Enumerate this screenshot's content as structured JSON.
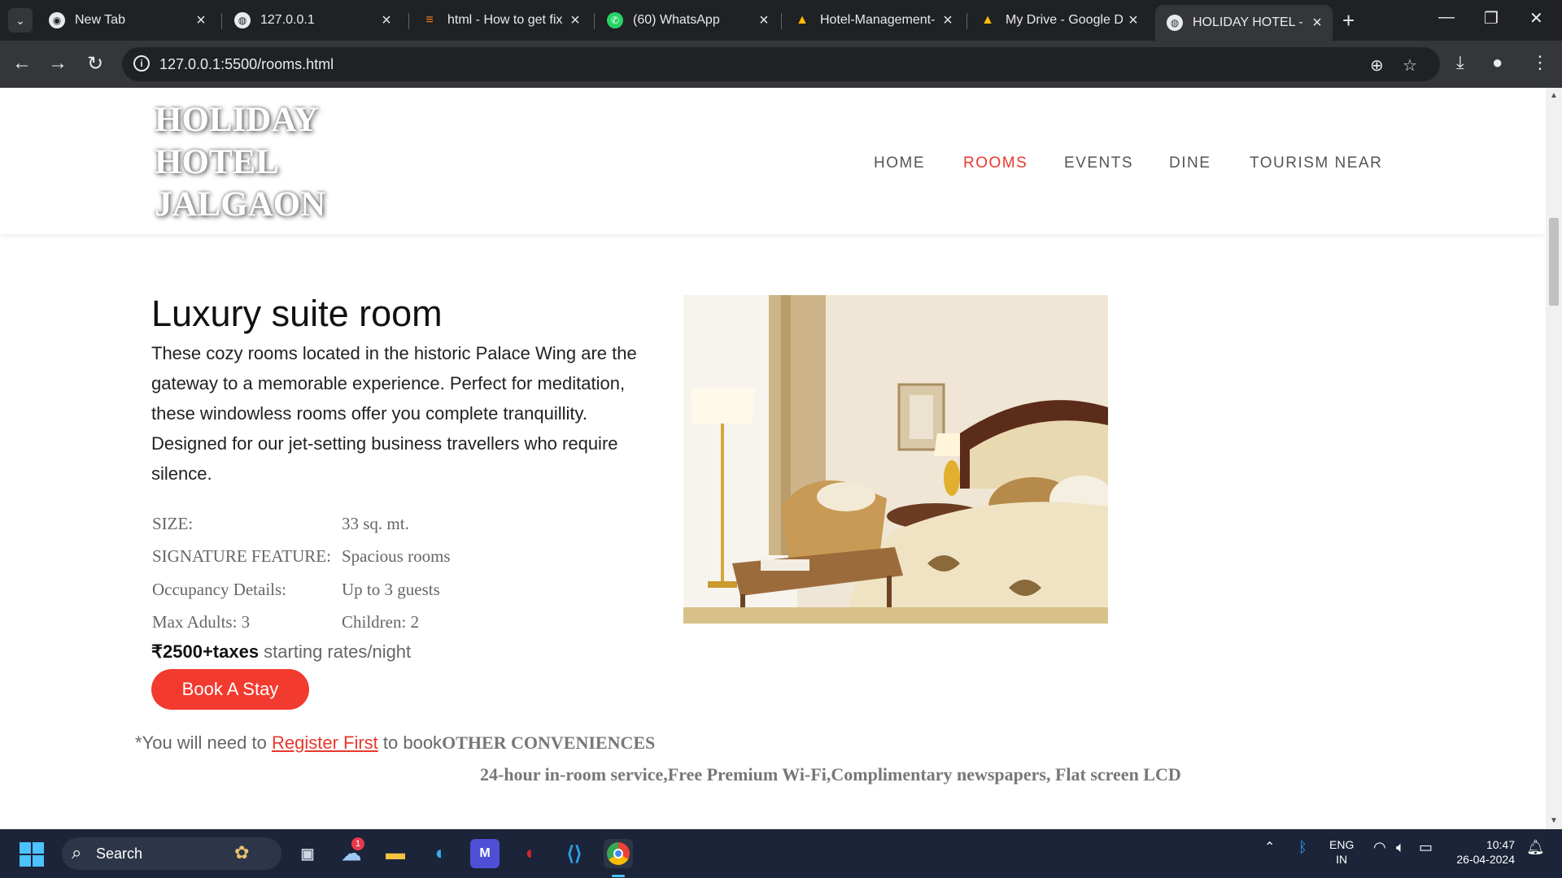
{
  "browser": {
    "tabs": [
      {
        "title": "New Tab"
      },
      {
        "title": "127.0.0.1"
      },
      {
        "title": "html - How to get fix"
      },
      {
        "title": "(60) WhatsApp"
      },
      {
        "title": "Hotel-Management-"
      },
      {
        "title": "My Drive - Google D"
      },
      {
        "title": "HOLIDAY HOTEL - JA"
      }
    ],
    "url": "127.0.0.1:5500/rooms.html"
  },
  "site": {
    "logo_lines": [
      "HOLIDAY",
      "HOTEL",
      "JALGAON"
    ],
    "nav": [
      "HOME",
      "ROOMS",
      "EVENTS",
      "DINE",
      "TOURISM NEAR"
    ],
    "active_nav": "ROOMS"
  },
  "room": {
    "title": "Luxury suite room",
    "description": "These cozy rooms located in the historic Palace Wing are the gateway to a memorable experience. Perfect for meditation, these windowless rooms offer you complete tranquillity. Designed for our jet-setting business travellers who require silence.",
    "specs": [
      {
        "label": "SIZE:",
        "value": "33 sq. mt."
      },
      {
        "label": "SIGNATURE FEATURE:",
        "value": "Spacious rooms"
      },
      {
        "label": "Occupancy Details:",
        "value": "Up to 3 guests"
      },
      {
        "label": "Max Adults: 3",
        "value": "Children: 2"
      }
    ],
    "price_bold": "₹2500+taxes",
    "price_rest": " starting rates/night",
    "book_label": "Book A Stay",
    "note_prefix": "*You will need to ",
    "note_link": "Register First",
    "note_suffix": " to book",
    "conveniences_title": "OTHER CONVENIENCES",
    "conveniences_list": "24-hour in-room service,Free Premium Wi-Fi,Complimentary newspapers, Flat screen LCD"
  },
  "taskbar": {
    "search_label": "Search",
    "badge": "1",
    "lang_line1": "ENG",
    "lang_line2": "IN",
    "time": "10:47",
    "date": "26-04-2024"
  }
}
